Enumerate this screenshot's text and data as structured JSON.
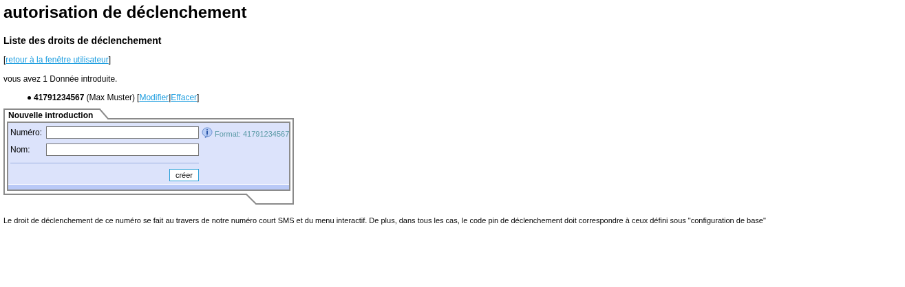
{
  "title": "autorisation de déclenchement",
  "subtitle": "Liste des droits de déclenchement",
  "back_link": {
    "open": "[",
    "label": "retour à la fenêtre utilisateur",
    "close": "]"
  },
  "count_text": "vous avez 1 Donnée introduite.",
  "entries": [
    {
      "number": "41791234567",
      "name": "(Max Muster)",
      "open": "[",
      "actions": [
        "Modifier",
        "Effacer"
      ],
      "separator": "|",
      "close": "]"
    }
  ],
  "form": {
    "legend": "Nouvelle introduction",
    "fields": [
      {
        "label": "Numéro:",
        "hint": "Format: 41791234567"
      },
      {
        "label": "Nom:"
      }
    ],
    "submit": "créer"
  },
  "note": "Le droit de déclenchement de ce numéro se fait au travers de notre numéro court SMS et du menu interactif. De plus, dans tous les cas, le code pin de déclenchement doit correspondre à ceux défini sous \"configuration de base\""
}
